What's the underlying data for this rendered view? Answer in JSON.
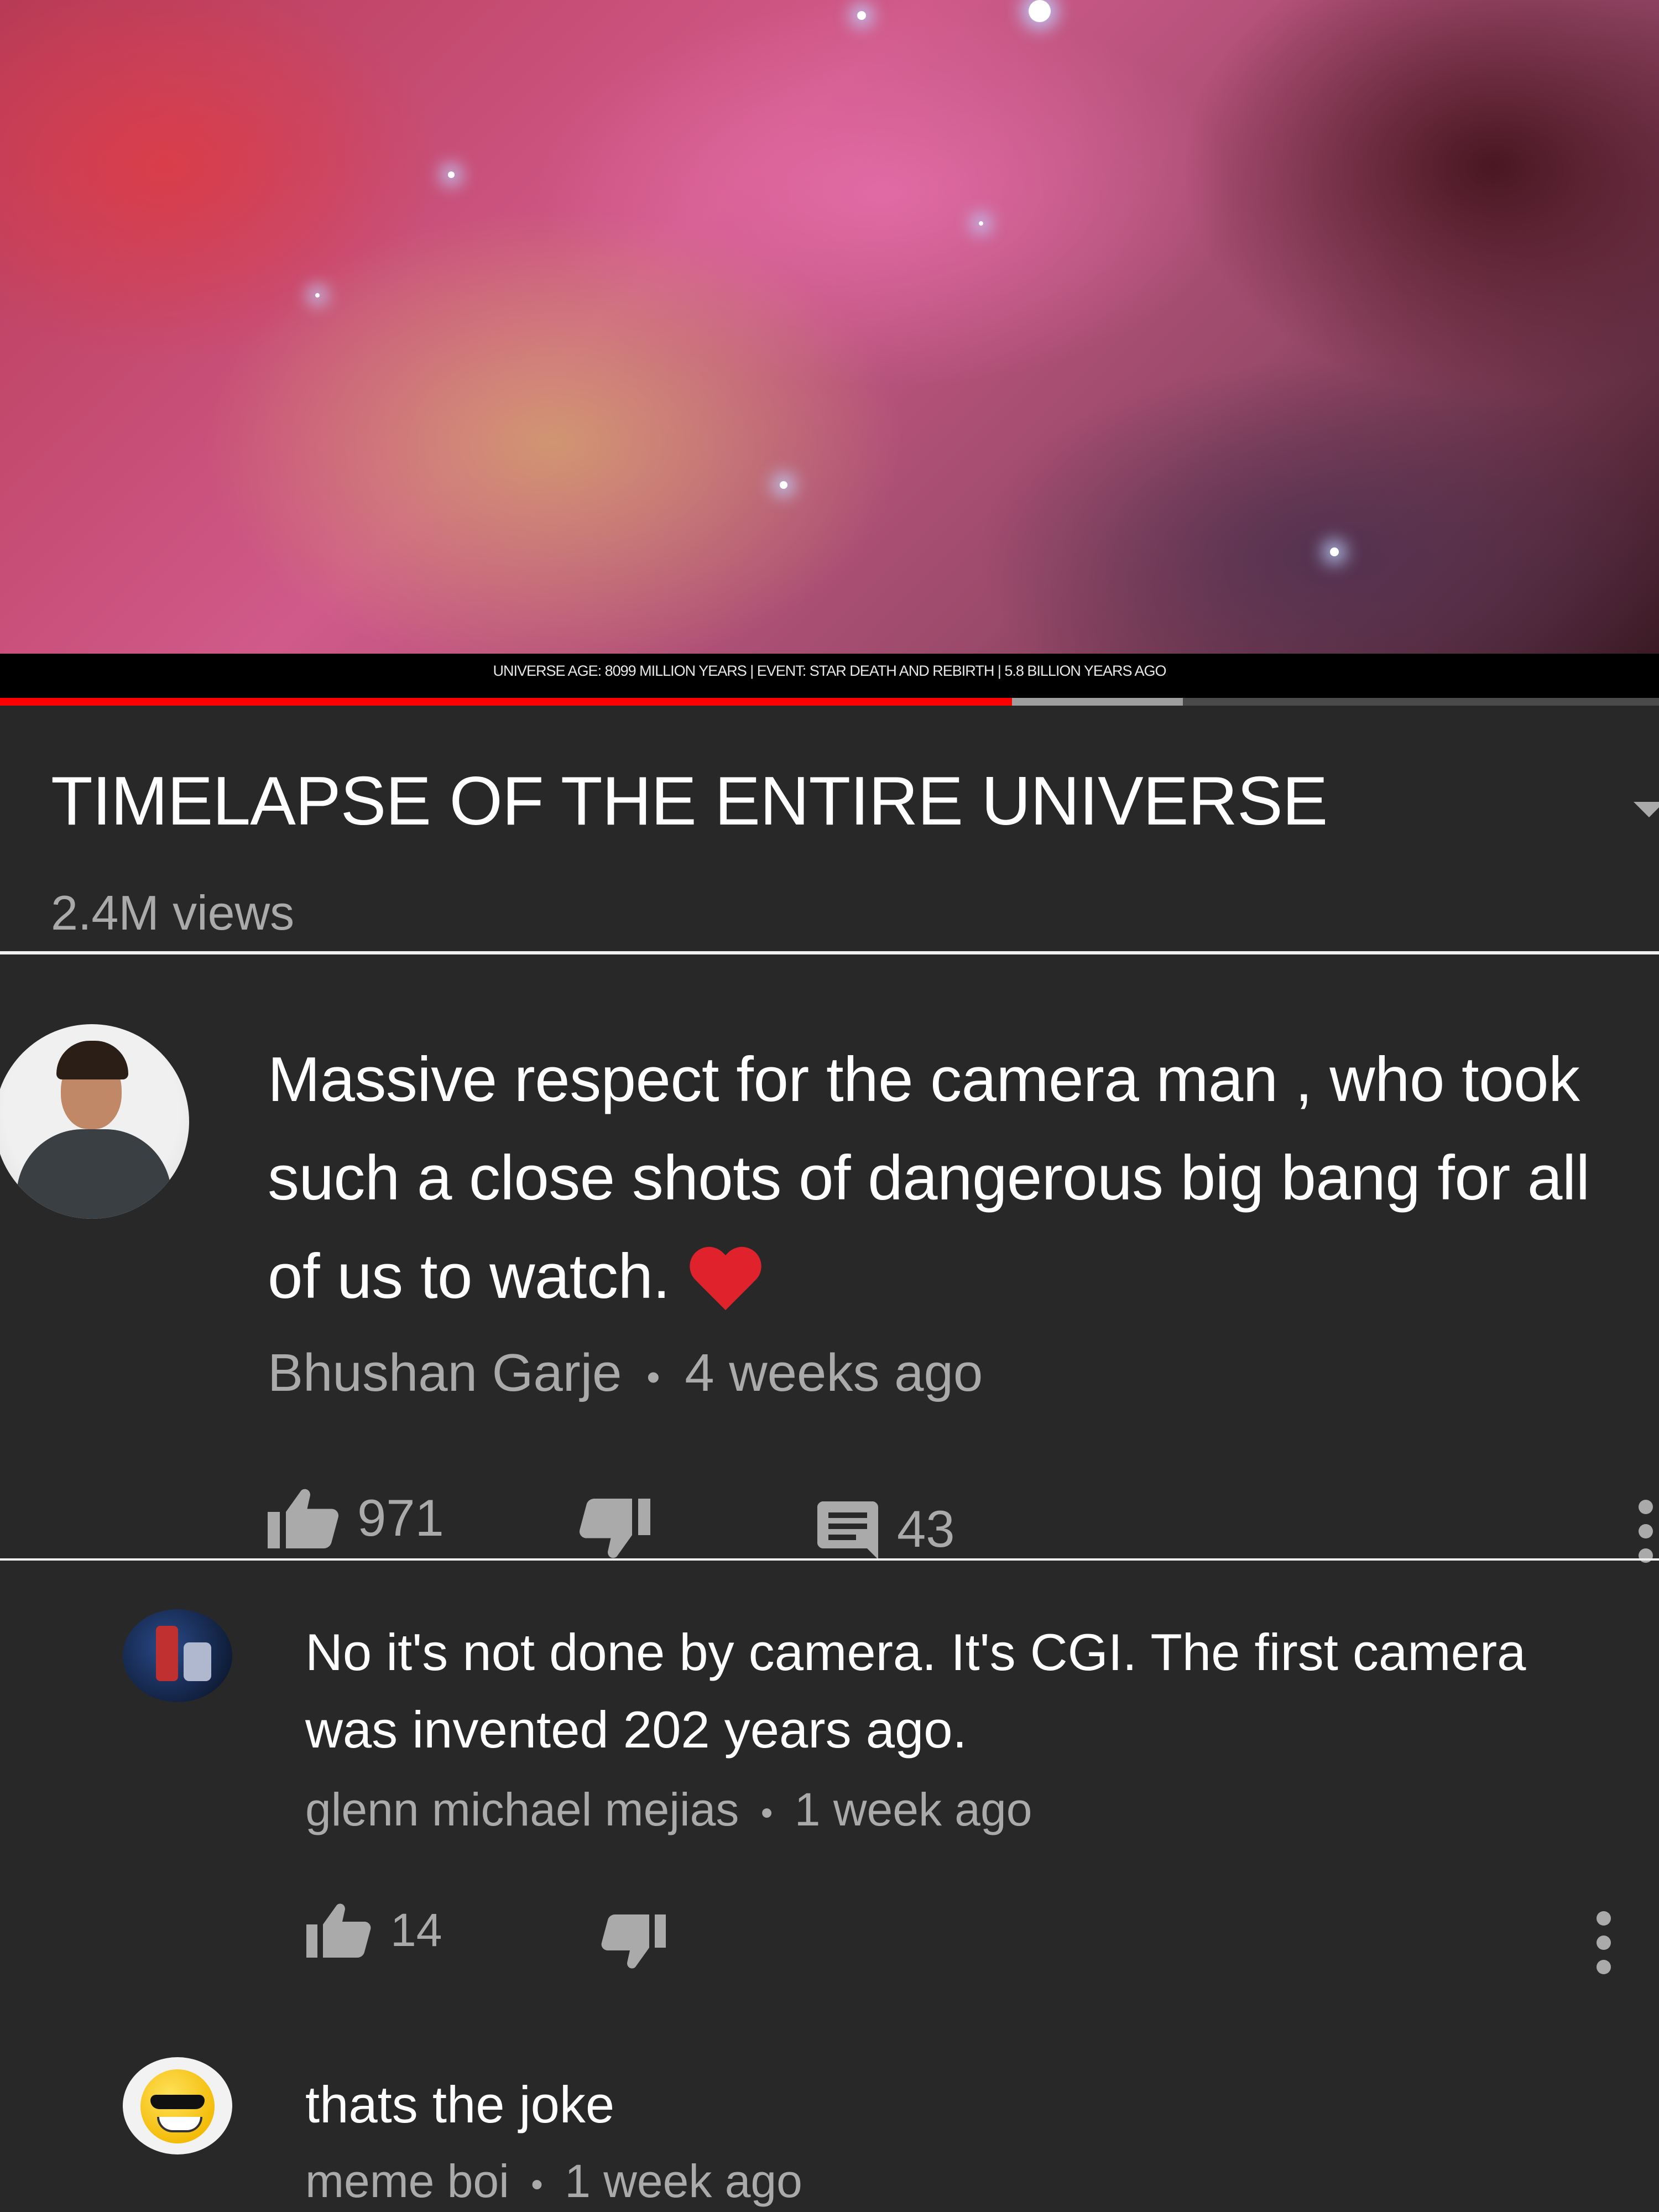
{
  "video": {
    "caption": "UNIVERSE AGE:  8099  MILLION YEARS  |  EVENT: STAR DEATH AND REBIRTH  |  5.8  BILLION YEARS AGO",
    "progress_played": 0.61,
    "progress_buffered": 0.713
  },
  "info": {
    "title": "TIMELAPSE OF THE ENTIRE UNIVERSE",
    "views": "2.4M views"
  },
  "comments": [
    {
      "text": "Massive respect for the camera man , who took such a close shots of dangerous big bang for all of us to watch.",
      "author": "Bhushan Garje",
      "time": "4 weeks ago",
      "likes": "971",
      "replies": "43"
    },
    {
      "text": "No it's not done by camera. It's CGI. The first camera was invented 202 years ago.",
      "author": "glenn michael mejias",
      "time": "1 week ago",
      "likes": "14"
    },
    {
      "text": "thats the joke",
      "author": "meme boi",
      "time": "1 week ago"
    }
  ],
  "separator": "•",
  "icons": {
    "like": "thumbs-up-icon",
    "dislike": "thumbs-down-icon",
    "reply": "comment-icon",
    "more": "more-vert-icon",
    "expand": "expand-triangle-icon"
  },
  "colors": {
    "background": "#282828",
    "progress": "#ff0000",
    "secondary_text": "#aaaaaa",
    "heart": "#e0222c"
  }
}
